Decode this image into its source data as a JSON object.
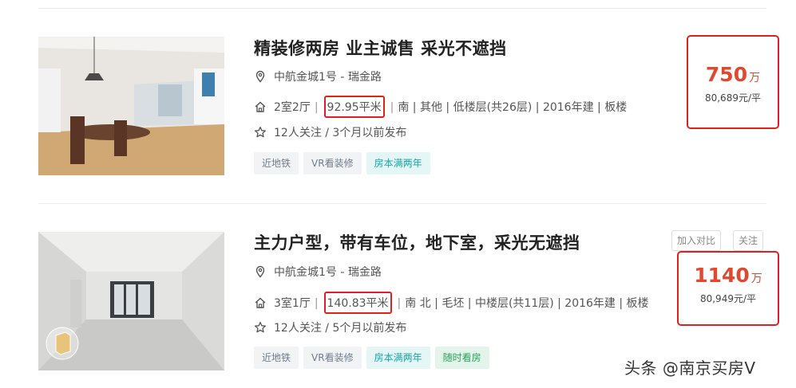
{
  "listings": [
    {
      "title": "精装修两房 业主诚售 采光不遮挡",
      "community": "中航金城1号 - 瑞金路",
      "layout": "2室2厅",
      "area": "92.95平米",
      "details": "南 | 其他 | 低楼层(共26层) | 2016年建 | 板楼",
      "follow": "12人关注 / 3个月以前发布",
      "tags": [
        "近地铁",
        "VR看装修",
        "房本满两年"
      ],
      "price_total": "750",
      "price_unit": "万",
      "price_per": "80,689元/平"
    },
    {
      "title": "主力户型，带有车位，地下室，采光无遮挡",
      "community": "中航金城1号 - 瑞金路",
      "layout": "3室1厅",
      "area": "140.83平米",
      "details": "南 北 | 毛坯 | 中楼层(共11层) | 2016年建 | 板楼",
      "follow": "12人关注 / 5个月以前发布",
      "tags": [
        "近地铁",
        "VR看装修",
        "房本满两年",
        "随时看房"
      ],
      "price_total": "1140",
      "price_unit": "万",
      "price_per": "80,949元/平",
      "actions": {
        "compare": "加入对比",
        "follow": "关注"
      }
    }
  ],
  "watermark": "头条 @南京买房V",
  "colors": {
    "price": "#e0482f",
    "highlight_box": "#e02020",
    "tag_teal": "#18a7a8",
    "tag_green": "#2aa15a"
  },
  "icons": [
    "location-pin-icon",
    "house-icon",
    "star-icon"
  ]
}
